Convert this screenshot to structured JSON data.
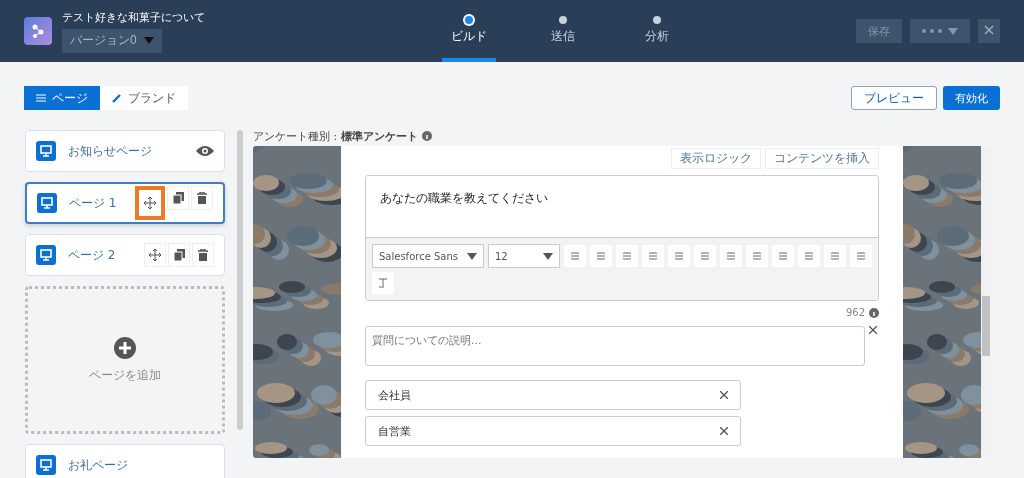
{
  "app": {
    "title": "テスト好きな和菓子について",
    "version": "バージョン0"
  },
  "steps": [
    {
      "label": "ビルド",
      "selected": true
    },
    {
      "label": "送信",
      "selected": false
    },
    {
      "label": "分析",
      "selected": false
    }
  ],
  "header_actions": {
    "save": "保存"
  },
  "view_tabs": [
    {
      "label": "ページ",
      "selected": true
    },
    {
      "label": "ブランド",
      "selected": false
    }
  ],
  "preview_button": "プレビュー",
  "activate_button": "有効化",
  "pages": [
    {
      "label": "お知らせページ",
      "kind": "welcome",
      "selected": false
    },
    {
      "label": "ページ 1",
      "kind": "page",
      "selected": true,
      "highlighted": true
    },
    {
      "label": "ページ 2",
      "kind": "page",
      "selected": false,
      "highlighted": false
    }
  ],
  "add_page": "ページを追加",
  "last_page": {
    "label": "お礼ページ"
  },
  "survey_type": "アンケート種別 : **標準アンケート**",
  "question_toolbar": [
    "表示ロジック",
    "コンテンツを挿入"
  ],
  "question": {
    "text": "あなたの職業を教えてください",
    "font": "Salesforce Sans",
    "size": "12",
    "char_count": "962",
    "description_placeholder": "質問についての説明..."
  },
  "options": [
    {
      "label": "会社員"
    },
    {
      "label": "自営業"
    }
  ]
}
